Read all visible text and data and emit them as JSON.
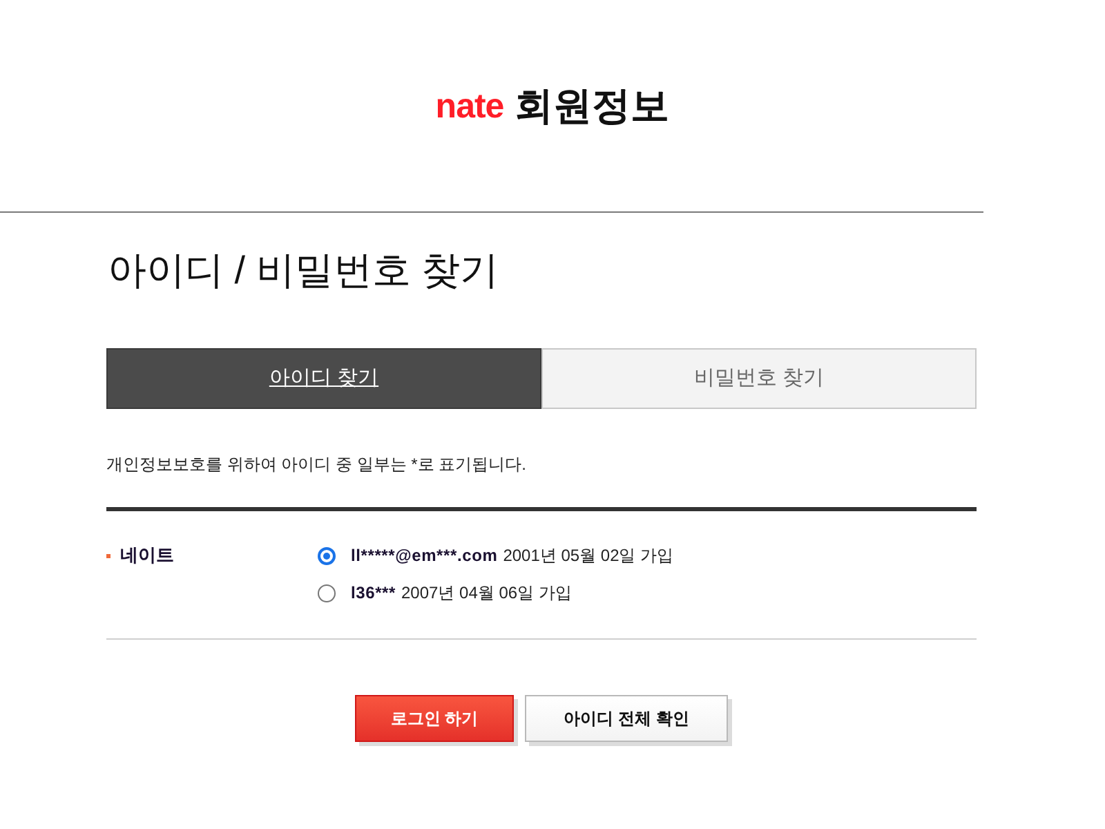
{
  "header": {
    "logo": "nate",
    "title": "회원정보"
  },
  "page_title": "아이디 / 비밀번호 찾기",
  "tabs": [
    {
      "label": "아이디 찾기",
      "selected": true
    },
    {
      "label": "비밀번호 찾기",
      "selected": false
    }
  ],
  "notice": "개인정보보호를 위하여 아이디 중 일부는 *로 표기됩니다.",
  "result": {
    "label": "네이트",
    "accounts": [
      {
        "id": "ll*****@em***.com",
        "joined": "2001년 05월 02일 가입",
        "selected": true
      },
      {
        "id": "l36***",
        "joined": "2007년 04월 06일 가입",
        "selected": false
      }
    ]
  },
  "buttons": [
    {
      "label": "로그인 하기",
      "kind": "primary"
    },
    {
      "label": "아이디 전체 확인",
      "kind": "secondary"
    }
  ]
}
